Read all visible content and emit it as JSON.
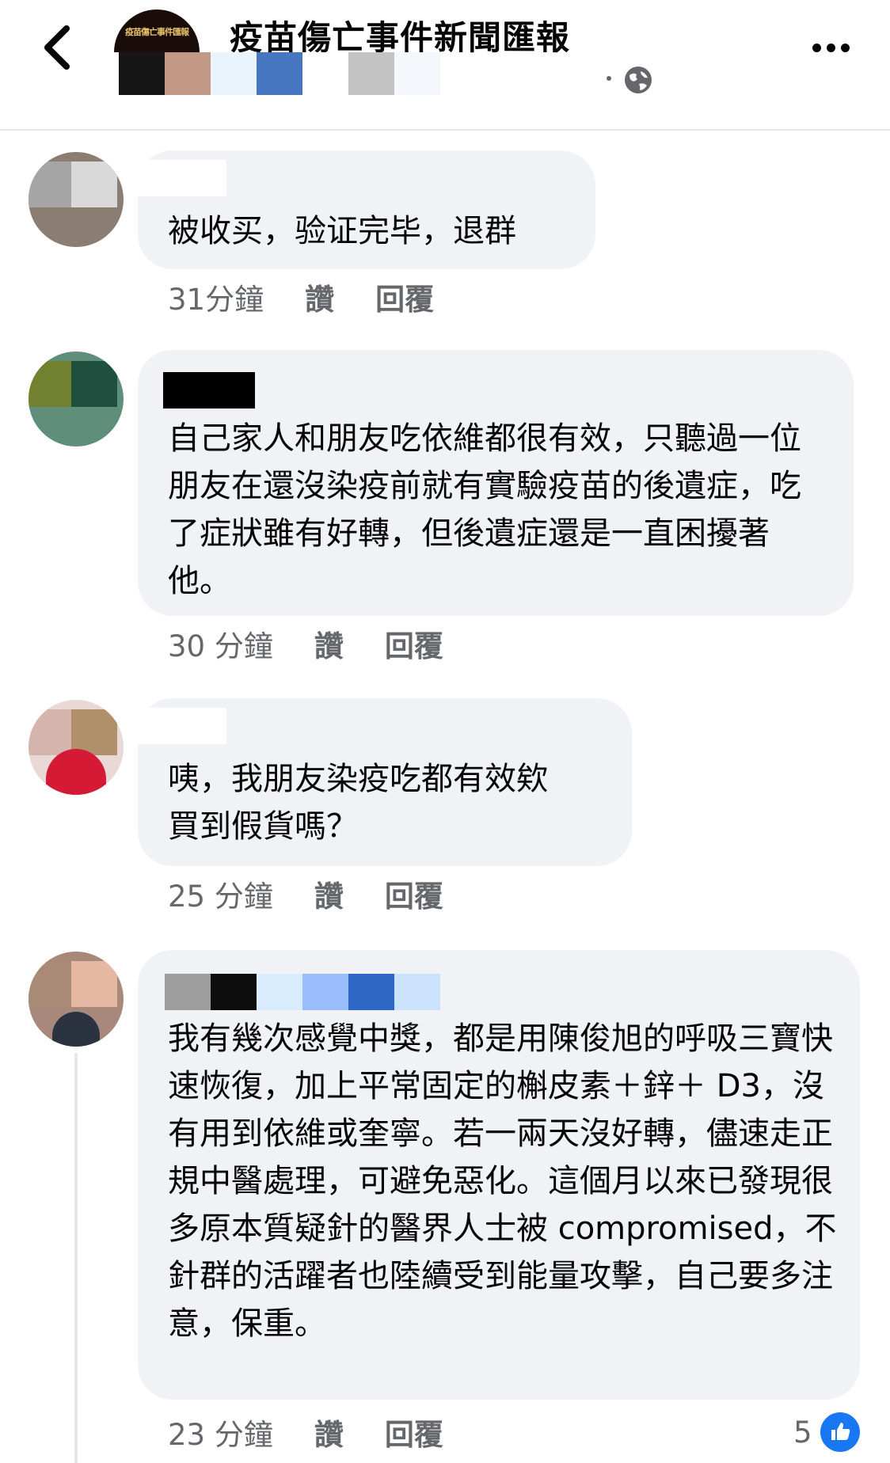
{
  "header": {
    "title": "疫苗傷亡事件新聞匯報",
    "logo_text": "疫苗傷亡事件匯報",
    "author_pixel_colors": [
      "#161616",
      "#c29887",
      "#eaf4fd",
      "#4677c0",
      "#ffffff",
      "#c3c3c3",
      "#f4f8fd"
    ]
  },
  "comments": [
    {
      "avatar_colors": [
        "#a5a5a5",
        "#d9d9d9"
      ],
      "author_colors": [
        "#ffffff"
      ],
      "text": "被收买，验证完毕，退群",
      "time": "31分鐘",
      "like": "讚",
      "reply": "回覆"
    },
    {
      "avatar_colors": [
        "#71812f",
        "#1f4f3e"
      ],
      "author_colors": [
        "#000000"
      ],
      "text": "自己家人和朋友吃依維都很有效，只聽過一位朋友在還沒染疫前就有實驗疫苗的後遺症，吃了症狀雖有好轉，但後遺症還是一直困擾著他。",
      "time": "30 分鐘",
      "like": "讚",
      "reply": "回覆"
    },
    {
      "avatar_colors": [
        "#d4b4ac",
        "#b0906a"
      ],
      "author_colors": [
        "#ffffff"
      ],
      "text": "咦，我朋友染疫吃都有效欸\n買到假貨嗎？",
      "time": "25 分鐘",
      "like": "讚",
      "reply": "回覆"
    },
    {
      "avatar_colors": [
        "#a88a76",
        "#e4b8a2"
      ],
      "author_colors": [
        "#9d9d9d",
        "#0c0c0c",
        "#d9ecfd",
        "#99bcfa",
        "#2d66c4",
        "#cbe2fd"
      ],
      "text": "我有幾次感覺中獎，都是用陳俊旭的呼吸三寶快速恢復，加上平常固定的槲皮素＋鋅＋ D3，沒有用到依維或奎寧。若一兩天沒好轉，儘速走正規中醫處理，可避免惡化。這個月以來已發現很多原本質疑針的醫界人士被 compromised，不針群的活躍者也陸續受到能量攻擊，自己要多注意，保重。",
      "time": "23 分鐘",
      "like": "讚",
      "reply": "回覆",
      "reaction_count": "5"
    }
  ],
  "icons": {
    "back": "chevron-left-icon",
    "more": "more-dots-icon",
    "privacy": "globe-icon",
    "reaction": "thumbs-up-icon"
  },
  "colors": {
    "bubble": "#f0f2f5",
    "secondary_text": "#65676b",
    "like_blue": "#1877f2"
  }
}
